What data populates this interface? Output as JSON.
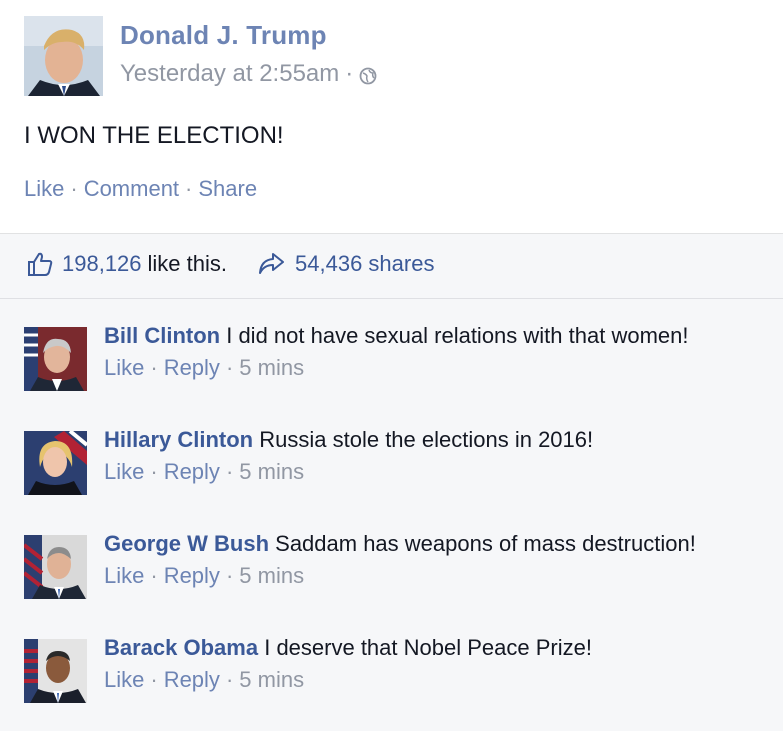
{
  "post": {
    "author": "Donald J. Trump",
    "timestamp": "Yesterday at 2:55am",
    "separator": "·",
    "text": "I WON THE ELECTION!",
    "actions": {
      "like": "Like",
      "comment": "Comment",
      "share": "Share"
    }
  },
  "stats": {
    "likes_count": "198,126",
    "likes_suffix": "like this.",
    "shares": "54,436 shares"
  },
  "comments": [
    {
      "author": "Bill Clinton",
      "text": "I did not have sexual relations with that women!",
      "like": "Like",
      "reply": "Reply",
      "time": "5 mins"
    },
    {
      "author": "Hillary Clinton",
      "text": "Russia stole the elections in 2016!",
      "like": "Like",
      "reply": "Reply",
      "time": "5 mins"
    },
    {
      "author": "George W Bush",
      "text": "Saddam has weapons of mass destruction!",
      "like": "Like",
      "reply": "Reply",
      "time": "5 mins"
    },
    {
      "author": "Barack Obama",
      "text": "I deserve that Nobel Peace Prize!",
      "like": "Like",
      "reply": "Reply",
      "time": "5 mins"
    }
  ],
  "colors": {
    "link": "#3b5998",
    "action_link": "#6d84b4",
    "muted": "#9197a3",
    "feedback_bg": "#f6f7f9"
  },
  "icons": {
    "globe": "globe-icon",
    "like": "thumbs-up-icon",
    "share": "share-arrow-icon"
  }
}
